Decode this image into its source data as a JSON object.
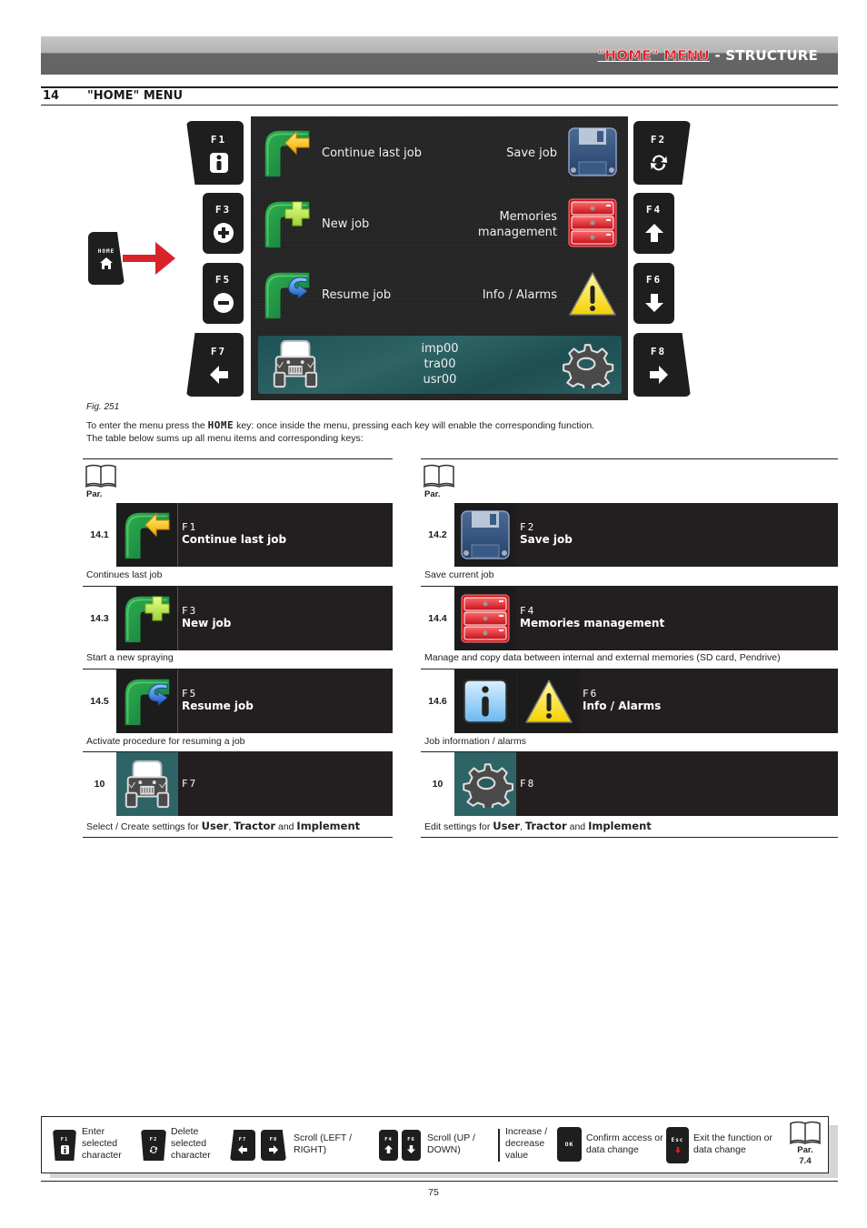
{
  "banner": {
    "title_highlight": "\"HOME\" MENU",
    "title_rest": " - STRUCTURE"
  },
  "section": {
    "number": "14",
    "title": "\"HOME\" MENU"
  },
  "keys": {
    "home": "HOME",
    "f1": "F1",
    "f2": "F2",
    "f3": "F3",
    "f4": "F4",
    "f5": "F5",
    "f6": "F6",
    "f7": "F7",
    "f8": "F8"
  },
  "screen": {
    "items": [
      {
        "label": "Continue last job",
        "icon": "continue-job-icon"
      },
      {
        "label": "Save job",
        "icon": "floppy-disk-icon"
      },
      {
        "label": "New job",
        "icon": "new-job-icon"
      },
      {
        "label_line1": "Memories",
        "label_line2": "management",
        "icon": "memory-drawers-icon"
      },
      {
        "label": "Resume job",
        "icon": "resume-job-icon"
      },
      {
        "label": "Info / Alarms",
        "icon": "warning-icon"
      }
    ],
    "status": {
      "implement": "imp00",
      "tractor": "tra00",
      "user": "usr00"
    }
  },
  "figure": {
    "caption": "Fig. 251"
  },
  "intro": {
    "line1_before": "To enter the menu press the ",
    "home_key": "HOME",
    "line1_after": " key: once inside the menu, pressing each key will enable the corresponding function.",
    "line2": "The table below sums up all menu items and corresponding keys:"
  },
  "table": {
    "par_label": "Par.",
    "left": [
      {
        "par": "14.1",
        "key": "F1",
        "name": "Continue last job",
        "desc": "Continues last job"
      },
      {
        "par": "14.3",
        "key": "F3",
        "name": "New job",
        "desc": "Start a new spraying"
      },
      {
        "par": "14.5",
        "key": "F5",
        "name": "Resume job",
        "desc": "Activate procedure for resuming a job"
      },
      {
        "par": "10",
        "key": "F7",
        "name": "",
        "desc_prefix": "Select / Create settings for ",
        "b1": "User",
        "sep1": ", ",
        "b2": "Tractor",
        "sep2": " and ",
        "b3": "Implement"
      }
    ],
    "right": [
      {
        "par": "14.2",
        "key": "F2",
        "name": "Save job",
        "desc": "Save current job"
      },
      {
        "par": "14.4",
        "key": "F4",
        "name": "Memories management",
        "desc": "Manage and copy data between internal and external memories (SD card, Pendrive)"
      },
      {
        "par": "14.6",
        "key": "F6",
        "name": "Info / Alarms",
        "desc": "Job information / alarms"
      },
      {
        "par": "10",
        "key": "F8",
        "name": "",
        "desc_prefix": "Edit settings for ",
        "b1": "User",
        "sep1": ", ",
        "b2": "Tractor",
        "sep2": " and ",
        "b3": "Implement"
      }
    ]
  },
  "legend": {
    "f1": {
      "key": "F1",
      "text": "Enter selected character"
    },
    "f2": {
      "key": "F2",
      "text": "Delete selected character"
    },
    "f7": "F7",
    "f8": "F8",
    "scroll_lr": "Scroll (LEFT / RIGHT)",
    "f4": "F4",
    "f6": "F6",
    "scroll_ud": "Scroll (UP / DOWN)",
    "incdec": "Increase / decrease value",
    "ok": {
      "key": "OK",
      "text": "Confirm access or data change"
    },
    "esc": {
      "key": "Esc",
      "text": "Exit the function or data change"
    },
    "par": "Par.",
    "par_num": "7.4"
  },
  "page_number": "75",
  "colors": {
    "accent_red": "#e01b24",
    "screen_bg": "#242424",
    "status_teal": "#2e6466",
    "table_dark": "#231f20"
  }
}
